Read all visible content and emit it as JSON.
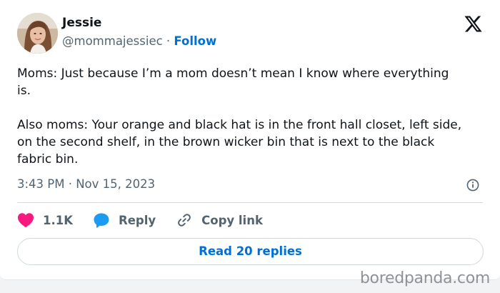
{
  "author": {
    "display_name": "Jessie",
    "handle": "@mommajessiec",
    "separator": "·",
    "follow_label": "Follow",
    "avatar_icon": "profile-photo-avatar"
  },
  "brand_icon": "x-logo-icon",
  "tweet": {
    "text": "Moms: Just because I’m a mom doesn’t mean I know where everything\nis.\n\nAlso moms: Your orange and black hat is in the front hall closet, left side,\non the second shelf, in the brown wicker bin that is next to the black\nfabric bin.",
    "timestamp": "3:43 PM · Nov 15, 2023"
  },
  "actions": {
    "likes_count": "1.1K",
    "reply_label": "Reply",
    "copy_link_label": "Copy link"
  },
  "read_replies_label": "Read 20 replies",
  "watermark": "boredpanda.com",
  "colors": {
    "like": "#f91880",
    "reply": "#1d9bf0",
    "link": "#006fd6",
    "text": "#0f1419",
    "muted": "#536471"
  }
}
